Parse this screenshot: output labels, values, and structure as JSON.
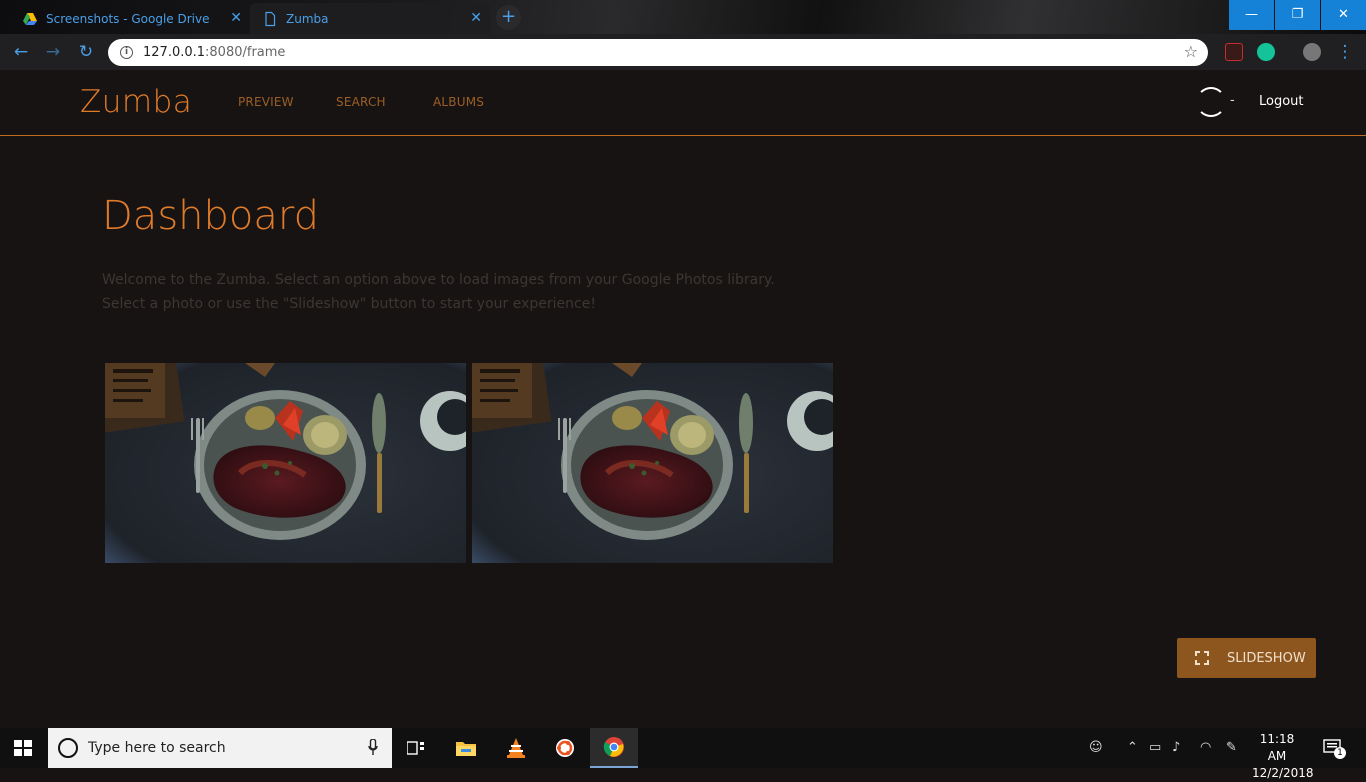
{
  "browser": {
    "tabs": [
      {
        "title": "Screenshots - Google Drive",
        "icon": "google-drive-icon",
        "close": "✕"
      },
      {
        "title": "Zumba",
        "icon": "document-icon",
        "close": "✕"
      }
    ],
    "new_tab": "+",
    "window_controls": {
      "minimize": "—",
      "restore": "❐",
      "close": "✕"
    },
    "url_host": "127.0.0.1",
    "url_path": ":8080/frame"
  },
  "app": {
    "brand": "Zumba",
    "nav": [
      {
        "label": "PREVIEW"
      },
      {
        "label": "SEARCH"
      },
      {
        "label": "ALBUMS"
      }
    ],
    "user_separator": "-",
    "logout": "Logout",
    "accent": "#e07b2a",
    "border": "#c36a22"
  },
  "main": {
    "title": "Dashboard",
    "intro_line1": "Welcome to the Zumba. Select an option above to load images from your Google Photos library.",
    "intro_line2": "Select a photo or use the \"Slideshow\" button to start your experience!",
    "photos": [
      {
        "subject": "plate-of-food-photo"
      },
      {
        "subject": "plate-of-food-photo"
      }
    ],
    "slideshow_label": "SLIDESHOW",
    "slideshow_color": "#8e561f"
  },
  "taskbar": {
    "search_placeholder": "Type here to search",
    "time": "11:18 AM",
    "date": "12/2/2018",
    "notification_count": "1"
  }
}
